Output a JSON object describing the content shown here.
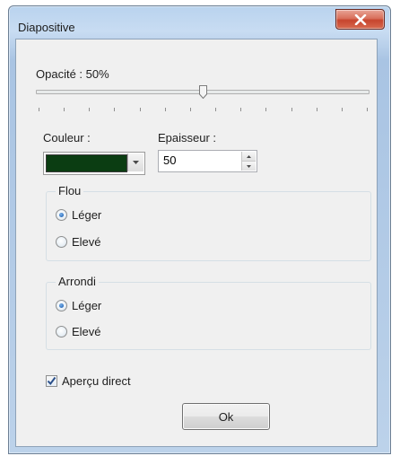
{
  "window": {
    "title": "Diapositive",
    "close_icon": "close-icon"
  },
  "opacity": {
    "label": "Opacité : 50%",
    "value_fraction": 0.5,
    "tick_count": 14
  },
  "color": {
    "label": "Couleur :",
    "swatch_hex": "#0b3d12",
    "dropdown_icon": "chevron-down-icon"
  },
  "thickness": {
    "label": "Epaisseur :",
    "value": "50"
  },
  "blur": {
    "title": "Flou",
    "options": [
      "Léger",
      "Elevé"
    ],
    "selected": "Léger"
  },
  "rounding": {
    "title": "Arrondi",
    "options": [
      "Léger",
      "Elevé"
    ],
    "selected": "Léger"
  },
  "live_preview": {
    "label": "Aperçu direct",
    "checked": true
  },
  "buttons": {
    "ok": "Ok"
  },
  "colors": {
    "accent_titlebar": "#b9d3ee",
    "close_button": "#c7452e",
    "dialog_bg": "#f0f0f0"
  }
}
